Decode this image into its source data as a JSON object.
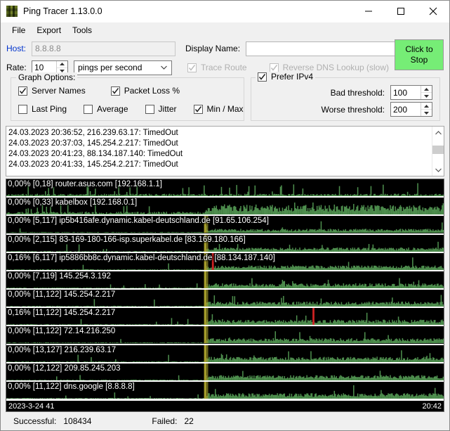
{
  "window": {
    "title": "Ping Tracer 1.13.0.0",
    "icon": "app-icon",
    "minimize": "─",
    "maximize": "□",
    "close": "✕"
  },
  "menu": {
    "items": [
      {
        "label": "File"
      },
      {
        "label": "Export"
      },
      {
        "label": "Tools"
      }
    ]
  },
  "controls": {
    "host_label": "Host:",
    "host_value": "8.8.8.8",
    "display_name_label": "Display Name:",
    "display_name_value": "",
    "rate_label": "Rate:",
    "rate_value": "10",
    "rate_unit": "pings per second",
    "trace_route_label": "Trace Route",
    "trace_route_checked": true,
    "trace_route_enabled": false,
    "reverse_dns_label": "Reverse DNS Lookup (slow)",
    "reverse_dns_checked": true,
    "reverse_dns_enabled": false,
    "stop_button_line1": "Click to",
    "stop_button_line2": "Stop",
    "stop_button_color": "#76ed76",
    "graph_options_title": "Graph Options:",
    "graph_options": [
      {
        "label": "Server Names",
        "checked": true
      },
      {
        "label": "Packet Loss %",
        "checked": true
      },
      {
        "label": "Last Ping",
        "checked": false
      },
      {
        "label": "Average",
        "checked": false
      },
      {
        "label": "Jitter",
        "checked": false
      },
      {
        "label": "Min / Max",
        "checked": true
      }
    ],
    "prefer_ipv4_label": "Prefer IPv4",
    "prefer_ipv4_checked": true,
    "bad_threshold_label": "Bad threshold:",
    "bad_threshold_value": "100",
    "worse_threshold_label": "Worse threshold:",
    "worse_threshold_value": "200"
  },
  "log": {
    "lines": [
      "24.03.2023 20:36:52, 216.239.63.17: TimedOut",
      "24.03.2023 20:37:03, 145.254.2.217: TimedOut",
      "24.03.2023 20:41:23, 88.134.187.140: TimedOut",
      "24.03.2023 20:41:33, 145.254.2.217: TimedOut"
    ]
  },
  "graph": {
    "rows": [
      {
        "label": "0,00% [0,18] router.asus.com [192.168.1.1]",
        "loss": "0,00%",
        "range": "[0,18]",
        "host": "router.asus.com [192.168.1.1]"
      },
      {
        "label": "0,00% [0,33] kabelbox [192.168.0.1]",
        "loss": "0,00%",
        "range": "[0,33]",
        "host": "kabelbox [192.168.0.1]"
      },
      {
        "label": "0,00% [5,117] ip5b416afe.dynamic.kabel-deutschland.de [91.65.106.254]",
        "loss": "0,00%",
        "range": "[5,117]",
        "host": "ip5b416afe.dynamic.kabel-deutschland.de [91.65.106.254]"
      },
      {
        "label": "0,00% [2,115] 83-169-180-166-isp.superkabel.de [83.169.180.166]",
        "loss": "0,00%",
        "range": "[2,115]",
        "host": "83-169-180-166-isp.superkabel.de [83.169.180.166]"
      },
      {
        "label": "0,16% [6,117] ip5886bb8c.dynamic.kabel-deutschland.de [88.134.187.140]",
        "loss": "0,16%",
        "range": "[6,117]",
        "host": "ip5886bb8c.dynamic.kabel-deutschland.de [88.134.187.140]"
      },
      {
        "label": "0,00% [7,119] 145.254.3.192",
        "loss": "0,00%",
        "range": "[7,119]",
        "host": "145.254.3.192"
      },
      {
        "label": "0,00% [11,122] 145.254.2.217",
        "loss": "0,00%",
        "range": "[11,122]",
        "host": "145.254.2.217"
      },
      {
        "label": "0,16% [11,122] 145.254.2.217",
        "loss": "0,16%",
        "range": "[11,122]",
        "host": "145.254.2.217"
      },
      {
        "label": "0,00% [11,122] 72.14.216.250",
        "loss": "0,00%",
        "range": "[11,122]",
        "host": "72.14.216.250"
      },
      {
        "label": "0,00% [13,127] 216.239.63.17",
        "loss": "0,00%",
        "range": "[13,127]",
        "host": "216.239.63.17"
      },
      {
        "label": "0,00% [12,122] 209.85.245.203",
        "loss": "0,00%",
        "range": "[12,122]",
        "host": "209.85.245.203"
      },
      {
        "label": "0,00% [11,122] dns.google [8.8.8.8]",
        "loss": "0,00%",
        "range": "[11,122]",
        "host": "dns.google [8.8.8.8]"
      }
    ],
    "time_start": "2023-3-24 41",
    "time_end": "20:42",
    "colors": {
      "background": "#000000",
      "wave": "#4e8f4e",
      "marker_bad": "#a39b2b",
      "marker_worse": "#cc2222",
      "separator": "#ffffff"
    }
  },
  "status": {
    "successful_label": "Successful:",
    "successful_value": "108434",
    "failed_label": "Failed:",
    "failed_value": "22"
  }
}
